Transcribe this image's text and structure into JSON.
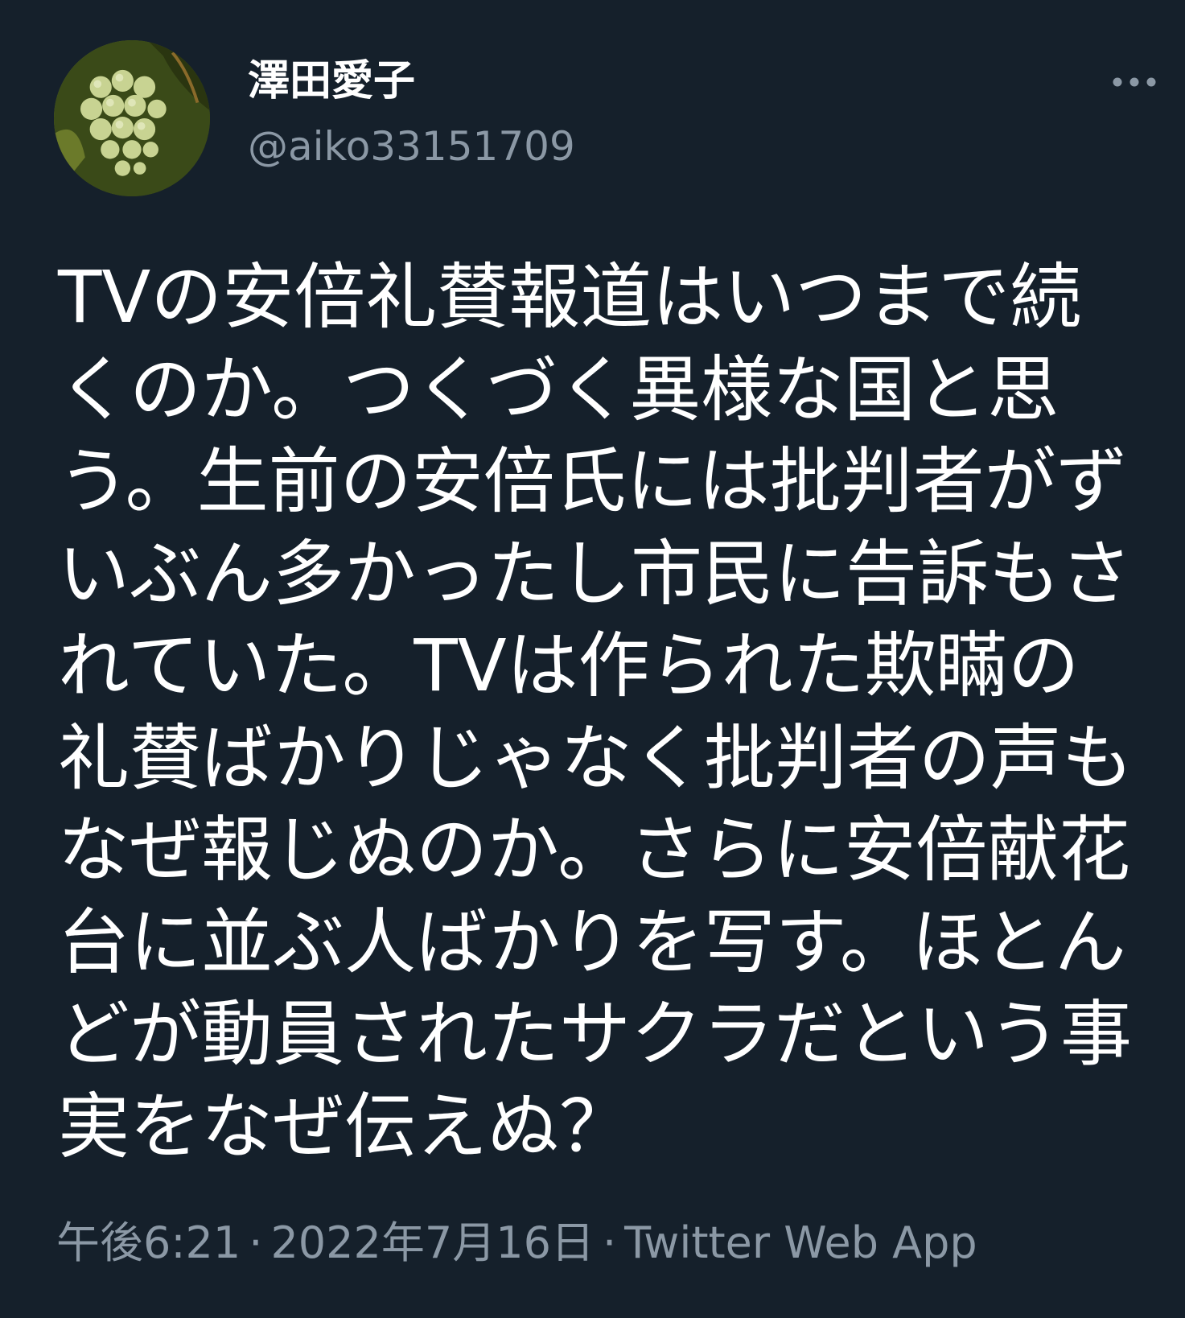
{
  "author": {
    "display_name": "澤田愛子",
    "handle": "@aiko33151709"
  },
  "tweet": {
    "text": "TVの安倍礼賛報道はいつまで続くのか。つくづく異様な国と思う。生前の安倍氏には批判者がずいぶん多かったし市民に告訴もされていた。TVは作られた欺瞞の礼賛ばかりじゃなく批判者の声もなぜ報じぬのか。さらに安倍献花台に並ぶ人ばかりを写す。ほとんどが動員されたサクラだという事実をなぜ伝えぬ？"
  },
  "meta": {
    "time": "午後6:21",
    "separator": "·",
    "date": "2022年7月16日",
    "source": "Twitter Web App"
  },
  "icons": {
    "avatar": "grapes-avatar",
    "more": "more-horizontal-icon"
  },
  "colors": {
    "background": "#15202b",
    "text_primary": "#ffffff",
    "text_secondary": "#8b98a5"
  }
}
